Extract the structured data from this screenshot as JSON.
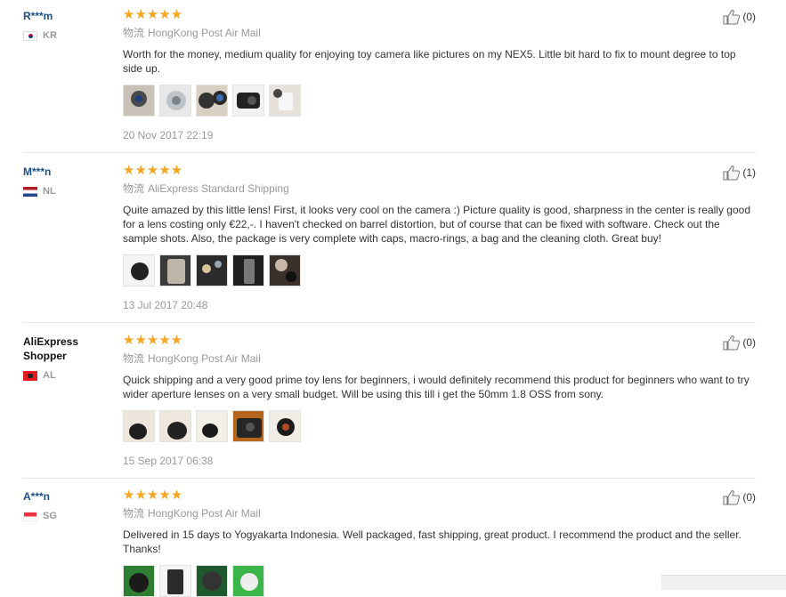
{
  "reviews": [
    {
      "user": "R***m",
      "country": "KR",
      "stars": "★★★★★",
      "shipping_tag": "物流",
      "shipping": "HongKong Post Air Mail",
      "text": "Worth for the money, medium quality for enjoying toy camera like pictures on my NEX5. Little bit hard to fix to mount degree to top side up.",
      "date": "20 Nov 2017 22:19",
      "helpful": "(0)"
    },
    {
      "user": "M***n",
      "country": "NL",
      "stars": "★★★★★",
      "shipping_tag": "物流",
      "shipping": "AliExpress Standard Shipping",
      "text": "Quite amazed by this little lens! First, it looks very cool on the camera :) Picture quality is good, sharpness in the center is really good for a lens costing only €22,-. I haven't checked on barrel distortion, but of course that can be fixed with software. Check out the sample shots. Also, the package is very complete with caps, macro-rings, a bag and the cleaning cloth. Great buy!",
      "date": "13 Jul 2017 20:48",
      "helpful": "(1)"
    },
    {
      "user": "AliExpress Shopper",
      "country": "AL",
      "stars": "★★★★★",
      "shipping_tag": "物流",
      "shipping": "HongKong Post Air Mail",
      "text": "Quick shipping and a very good prime toy lens for beginners, i would definitely recommend this product for beginners who want to try wider aperture lenses on a very small budget. Will be using this till i get the 50mm 1.8 OSS from sony.",
      "date": "15 Sep 2017 06:38",
      "helpful": "(0)"
    },
    {
      "user": "A***n",
      "country": "SG",
      "stars": "★★★★★",
      "shipping_tag": "物流",
      "shipping": "HongKong Post Air Mail",
      "text": "Delivered in 15 days to Yogyakarta Indonesia. Well packaged, fast shipping, great product. I recommend the product and the seller. Thanks!",
      "date": "",
      "helpful": "(0)"
    }
  ],
  "colors": {
    "star": "#f5a623",
    "username": "#1a4f8b",
    "meta": "#999999"
  }
}
